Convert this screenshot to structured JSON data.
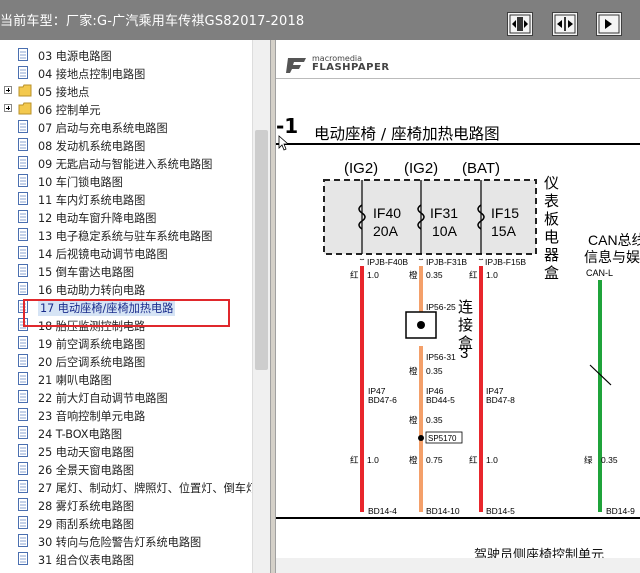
{
  "window": {
    "title": "当前车型：厂家:G-广汽乘用车传祺GS82017-2018",
    "buttons": [
      {
        "name": "fit-width-button",
        "icon": "fit-width-icon"
      },
      {
        "name": "fit-page-button",
        "icon": "fit-page-icon"
      },
      {
        "name": "actual-size-button",
        "icon": "actual-size-icon"
      }
    ]
  },
  "tree": {
    "items": [
      {
        "label": "03 电源电路图",
        "type": "doc"
      },
      {
        "label": "04 接地点控制电路图",
        "type": "doc"
      },
      {
        "label": "05 接地点",
        "type": "folder"
      },
      {
        "label": "06 控制单元",
        "type": "folder"
      },
      {
        "label": "07 启动与充电系统电路图",
        "type": "doc"
      },
      {
        "label": "08 发动机系统电路图",
        "type": "doc"
      },
      {
        "label": "09 无匙启动与智能进入系统电路图",
        "type": "doc"
      },
      {
        "label": "10 车门锁电路图",
        "type": "doc"
      },
      {
        "label": "11 车内灯系统电路图",
        "type": "doc"
      },
      {
        "label": "12 电动车窗升降电路图",
        "type": "doc"
      },
      {
        "label": "13 电子稳定系统与驻车系统电路图",
        "type": "doc"
      },
      {
        "label": "14 后视镜电动调节电路图",
        "type": "doc"
      },
      {
        "label": "15 倒车雷达电路图",
        "type": "doc"
      },
      {
        "label": "16 电动助力转向电路",
        "type": "doc"
      },
      {
        "label": "17 电动座椅/座椅加热电路",
        "type": "doc",
        "selected": true
      },
      {
        "label": "18 胎压监测控制电路",
        "type": "doc"
      },
      {
        "label": "19 前空调系统电路图",
        "type": "doc"
      },
      {
        "label": "20 后空调系统电路图",
        "type": "doc"
      },
      {
        "label": "21 喇叭电路图",
        "type": "doc"
      },
      {
        "label": "22 前大灯自动调节电路图",
        "type": "doc"
      },
      {
        "label": "23 音响控制单元电路",
        "type": "doc"
      },
      {
        "label": "24 T-BOX电路图",
        "type": "doc"
      },
      {
        "label": "25 电动天窗电路图",
        "type": "doc"
      },
      {
        "label": "26 全景天窗电路图",
        "type": "doc"
      },
      {
        "label": "27 尾灯、制动灯、牌照灯、位置灯、倒车灯",
        "type": "doc"
      },
      {
        "label": "28 雾灯系统电路图",
        "type": "doc"
      },
      {
        "label": "29 雨刮系统电路图",
        "type": "doc"
      },
      {
        "label": "30 转向与危险警告灯系统电路图",
        "type": "doc"
      },
      {
        "label": "31 组合仪表电路图",
        "type": "doc"
      }
    ]
  },
  "viewer": {
    "logo_line1": "macromedia",
    "logo_line2": "FLASHPAPER",
    "page_number": "-1",
    "page_title": "电动座椅 / 座椅加热电路图",
    "footer_text": "驾驶员侧座椅控制单元",
    "colors": {
      "red_wire": "#e8262c",
      "orange_wire": "#f4a06a",
      "green_wire": "#1fa33a",
      "fuse_box_bg": "#e6e6e6"
    }
  },
  "diagram": {
    "power_labels": [
      "(IG2)",
      "(IG2)",
      "(BAT)"
    ],
    "fuses": [
      {
        "name": "IF40",
        "rating": "20A"
      },
      {
        "name": "IF31",
        "rating": "10A"
      },
      {
        "name": "IF15",
        "rating": "15A"
      }
    ],
    "fuse_box_label": [
      "仪",
      "表",
      "板",
      "电",
      "器",
      "盒"
    ],
    "can_label": [
      "CAN总线",
      "信息与娱"
    ],
    "can_pin": "CAN-L",
    "pins": {
      "p1": "IPJB-F40B",
      "p2": "IPJB-F31B",
      "p3": "IPJB-F15B",
      "w1": "红",
      "w1s": "1.0",
      "w2": "橙",
      "w2s": "0.35",
      "w3": "红",
      "w3s": "1.0",
      "ip56_25": "IP56-25",
      "ip56_31": "IP56-31",
      "conn": [
        "连",
        "接",
        "盒",
        "3"
      ],
      "w4": "橙",
      "w4s": "0.35",
      "ip47a": "IP47",
      "bd47_6": "BD47-6",
      "ip46": "IP46",
      "bd44_5": "BD44-5",
      "ip47b": "IP47",
      "bd47_8": "BD47-8",
      "w5": "橙",
      "w5s": "0.35",
      "sp": "SP5170",
      "w6": "红",
      "w6s": "1.0",
      "w7": "橙",
      "w7s": "0.75",
      "w8": "红",
      "w8s": "1.0",
      "w9": "绿",
      "w9s": "0.35",
      "bd14_4": "BD14-4",
      "bd14_10": "BD14-10",
      "bd14_5": "BD14-5",
      "bd14_9": "BD14-9"
    }
  }
}
